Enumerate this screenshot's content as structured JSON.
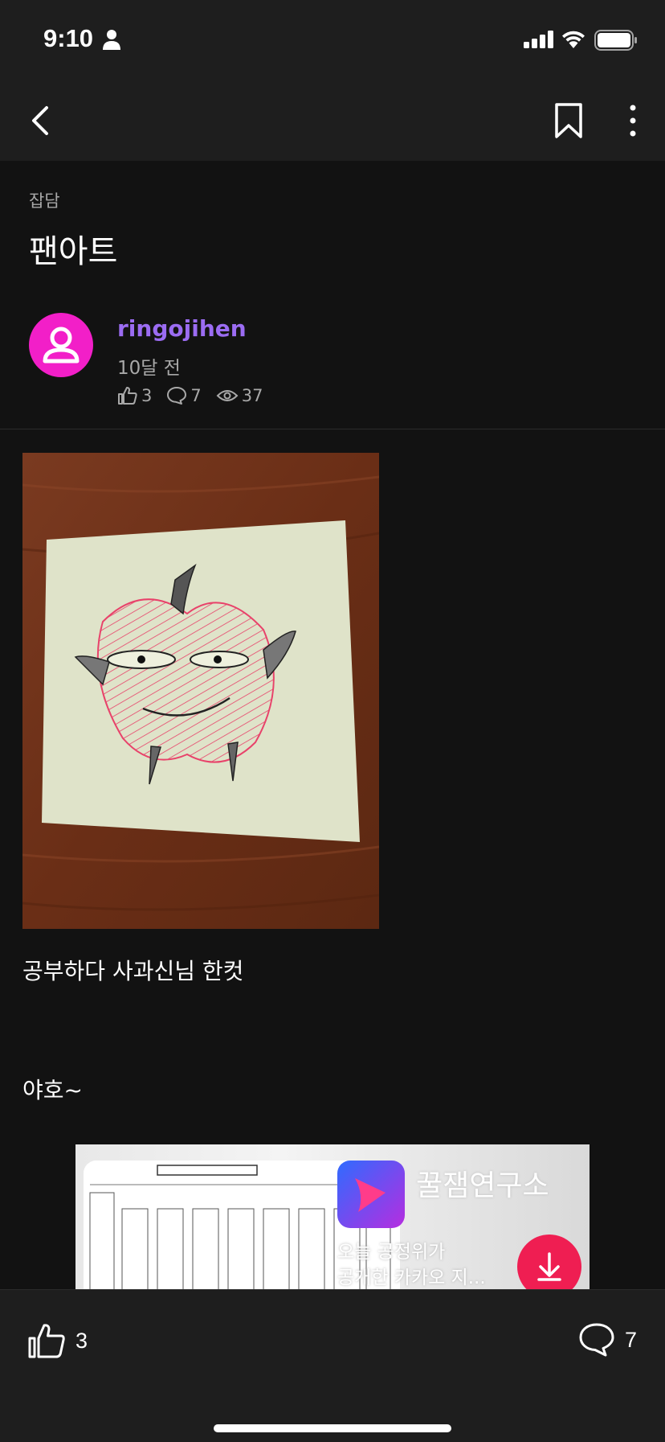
{
  "status_bar": {
    "time": "9:10"
  },
  "post": {
    "category": "잡담",
    "title": "팬아트",
    "author": "ringojihen",
    "time_ago": "10달 전",
    "likes": "3",
    "comments": "7",
    "views": "37",
    "body_lines": [
      "공부하다 사과신님 한컷",
      "야호~"
    ]
  },
  "ad": {
    "app_name": "꿀잼연구소",
    "description_line1": "오늘 공정위가",
    "description_line2": "공개한 카카오 지..."
  },
  "bottom_bar": {
    "like_count": "3",
    "comment_count": "7"
  },
  "colors": {
    "background": "#121212",
    "bar": "#1e1e1e",
    "author": "#9b6cf2",
    "avatar": "#f21fc8"
  }
}
